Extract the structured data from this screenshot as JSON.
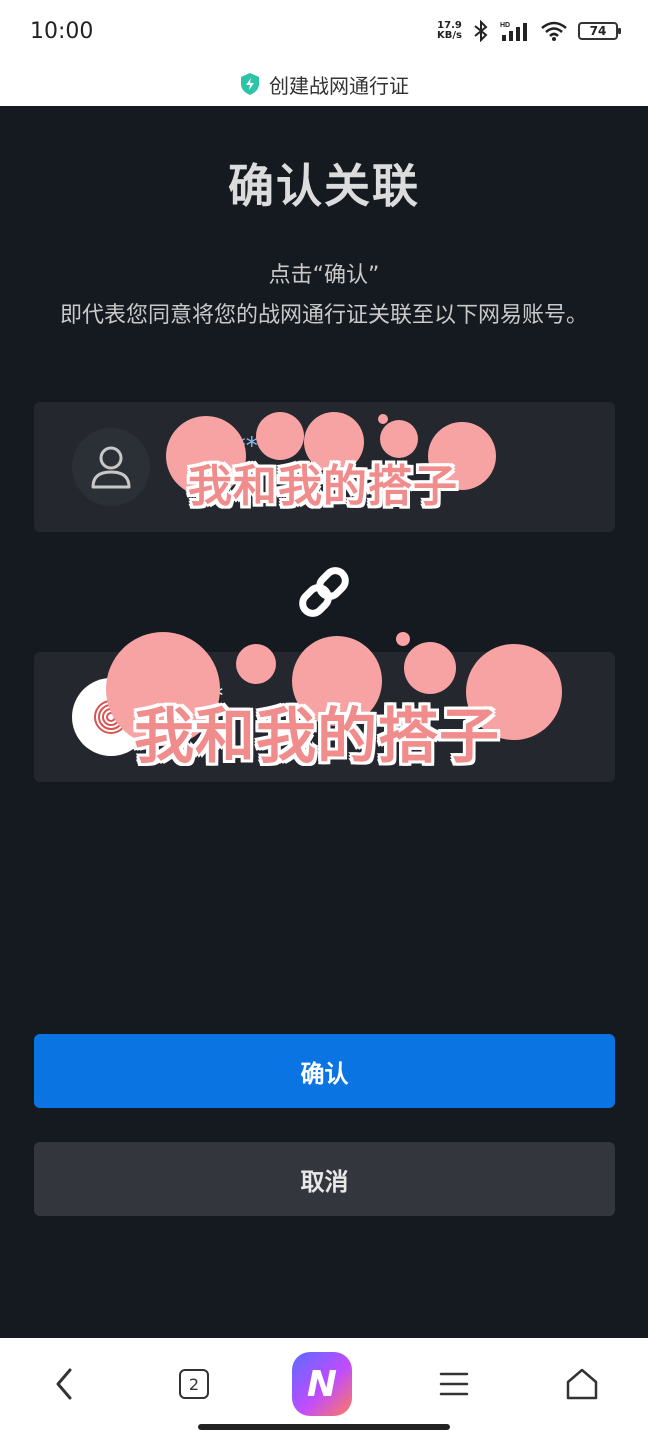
{
  "status_bar": {
    "time": "10:00",
    "net_speed_value": "17.9",
    "net_speed_unit": "KB/s",
    "battery": "74"
  },
  "header": {
    "title": "创建战网通行证",
    "icon": "shield-bolt-icon",
    "accent": "#2cc3a6"
  },
  "main": {
    "title": "确认关联",
    "description_line1": "点击“确认”",
    "description_line2": "即代表您同意将您的战网通行证关联至以下网易账号。"
  },
  "accounts": [
    {
      "name": "uike***15",
      "sub": "m",
      "avatar_icon": "user-icon"
    },
    {
      "name": "5**",
      "sub": "",
      "avatar_icon": "fingerprint-icon"
    }
  ],
  "link_icon": "chain-link-icon",
  "stickers": [
    {
      "text": "我和我的搭子"
    },
    {
      "text": "我和我的搭子"
    }
  ],
  "buttons": {
    "confirm": "确认",
    "cancel": "取消",
    "confirm_color": "#0a74e3"
  },
  "nav": {
    "back_icon": "chevron-left-icon",
    "tab_count": "2",
    "app_label": "N",
    "menu_icon": "menu-icon",
    "home_icon": "home-icon"
  }
}
